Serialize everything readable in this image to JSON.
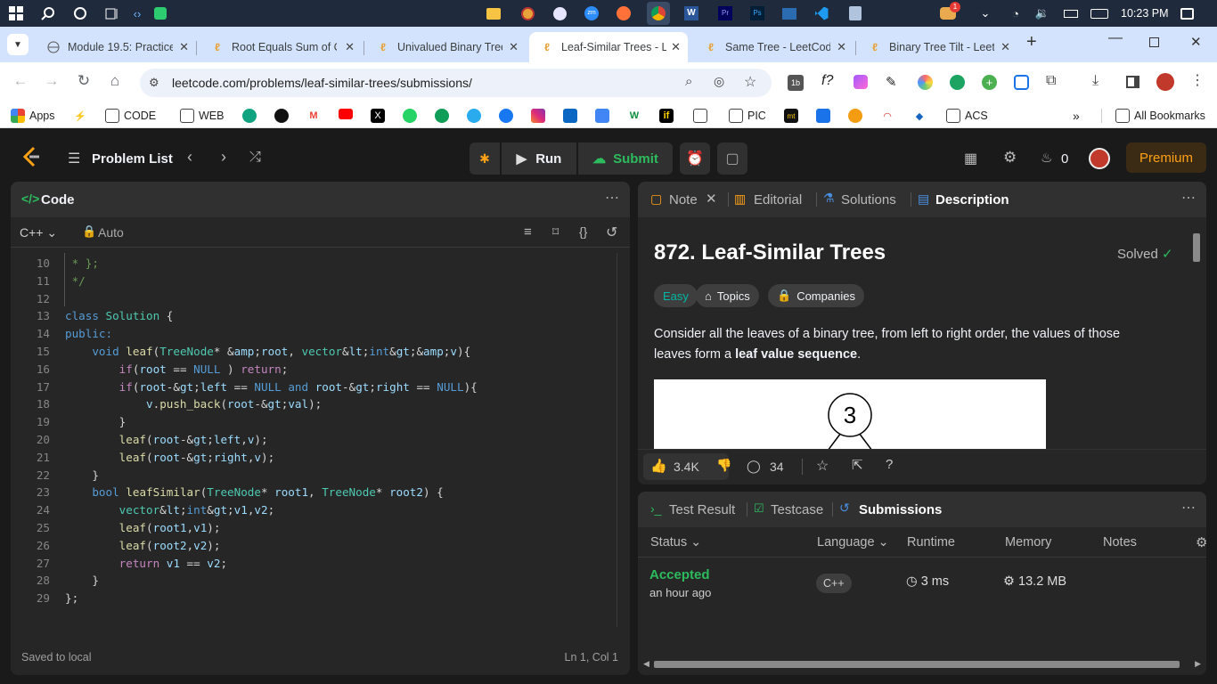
{
  "taskbar": {
    "clock": "10:23 PM",
    "notif_badge": "1"
  },
  "tabs": [
    {
      "title": "Module 19.5: Practice"
    },
    {
      "title": "Root Equals Sum of C"
    },
    {
      "title": "Univalued Binary Tree"
    },
    {
      "title": "Leaf-Similar Trees - Le"
    },
    {
      "title": "Same Tree - LeetCode"
    },
    {
      "title": "Binary Tree Tilt - Leetc"
    }
  ],
  "address": {
    "url": "leetcode.com/problems/leaf-similar-trees/submissions/"
  },
  "toolbar": {
    "f_label": "f?"
  },
  "bookmarks": {
    "items": [
      "Apps",
      "CODE",
      "WEB",
      "PIC",
      "ACS"
    ],
    "all": "All Bookmarks"
  },
  "lcnav": {
    "problem_list": "Problem List",
    "run": "Run",
    "submit": "Submit",
    "streak": "0",
    "premium": "Premium"
  },
  "code_panel": {
    "title": "Code",
    "language": "C++",
    "mode": "Auto",
    "status": "Saved to local",
    "cursor": "Ln 1, Col 1",
    "lines": [
      {
        "n": "10",
        "text": " * };"
      },
      {
        "n": "11",
        "text": " */"
      },
      {
        "n": "12",
        "text": ""
      },
      {
        "n": "13",
        "text": "class Solution {"
      },
      {
        "n": "14",
        "text": "public:"
      },
      {
        "n": "15",
        "text": "    void leaf(TreeNode* &root, vector<int>&v){"
      },
      {
        "n": "16",
        "text": "        if(root == NULL ) return;"
      },
      {
        "n": "17",
        "text": "        if(root->left == NULL and root->right == NULL){"
      },
      {
        "n": "18",
        "text": "            v.push_back(root->val);"
      },
      {
        "n": "19",
        "text": "        }"
      },
      {
        "n": "20",
        "text": "        leaf(root->left,v);"
      },
      {
        "n": "21",
        "text": "        leaf(root->right,v);"
      },
      {
        "n": "22",
        "text": "    }"
      },
      {
        "n": "23",
        "text": "    bool leafSimilar(TreeNode* root1, TreeNode* root2) {"
      },
      {
        "n": "24",
        "text": "        vector<int>v1,v2;"
      },
      {
        "n": "25",
        "text": "        leaf(root1,v1);"
      },
      {
        "n": "26",
        "text": "        leaf(root2,v2);"
      },
      {
        "n": "27",
        "text": "        return v1 == v2;"
      },
      {
        "n": "28",
        "text": "    }"
      },
      {
        "n": "29",
        "text": "};"
      }
    ]
  },
  "desc_panel": {
    "tabs": [
      "Note",
      "Editorial",
      "Solutions",
      "Description"
    ],
    "title": "872. Leaf-Similar Trees",
    "solved": "Solved",
    "difficulty": "Easy",
    "topics": "Topics",
    "companies": "Companies",
    "body1": "Consider all the leaves of a binary tree, from left to right order, the values of those leaves form a ",
    "body_bold": "leaf value sequence",
    "body_end": ".",
    "tree_root": "3",
    "likes": "3.4K",
    "comments": "34"
  },
  "result_panel": {
    "tabs": [
      "Test Result",
      "Testcase",
      "Submissions"
    ],
    "headers": {
      "status": "Status",
      "language": "Language",
      "runtime": "Runtime",
      "memory": "Memory",
      "notes": "Notes"
    },
    "row": {
      "status": "Accepted",
      "time": "an hour ago",
      "language": "C++",
      "runtime": "3 ms",
      "memory": "13.2 MB"
    }
  },
  "colors": {
    "accent_green": "#2cbb5d",
    "easy": "#00b8a3",
    "premium": "#ffa116"
  }
}
